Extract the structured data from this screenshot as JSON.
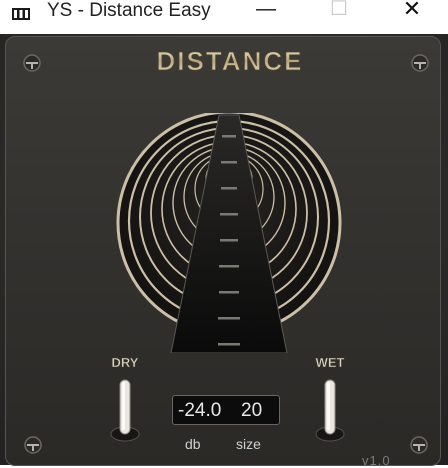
{
  "window": {
    "title": "YS - Distance Easy",
    "minimize_glyph": "—",
    "maximize_glyph": "☐",
    "close_glyph": "✕"
  },
  "plugin": {
    "logo_text": "DISTANCE",
    "dry_label": "DRY",
    "wet_label": "WET",
    "readout": {
      "db_value": "-24.0",
      "size_value": "20"
    },
    "db_label": "db",
    "size_label": "size",
    "version": "v1.0"
  },
  "controls": {
    "dry_switch": "up",
    "wet_switch": "up"
  },
  "icons": [
    "app-icon",
    "screw-icon",
    "tunnel-meter",
    "toggle-switch"
  ],
  "colors": {
    "panel": "#33312e",
    "logo_chrome": "#d9c9a3",
    "ring": "#cbbfa6",
    "display_bg": "#0c0c0c",
    "display_text": "#e8e8e8"
  }
}
